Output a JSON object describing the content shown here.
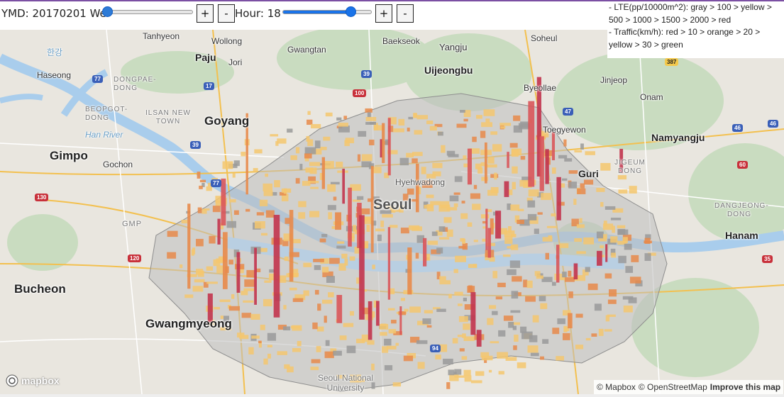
{
  "controls": {
    "ymd_label": "YMD: 20170201 We",
    "ymd_slider_level": 0.02,
    "ymd_plus": "+",
    "ymd_minus": "-",
    "hour_label": "Hour: 18",
    "hour_slider_level": 0.75,
    "hour_plus": "+",
    "hour_minus": "-"
  },
  "legend": {
    "lte": "- LTE(pp/10000m^2): gray > 100 > yellow > 500 > 1000 > 1500 > 2000 > red",
    "traffic": "- Traffic(km/h): red > 10 > orange > 20 > yellow > 30 > green"
  },
  "map": {
    "cities": [
      "Goyang",
      "Gimpo",
      "Bucheon",
      "Gwangmyeong",
      "Seoul",
      "Guri",
      "Namyangju",
      "Hanam",
      "Uijeongbu",
      "Paju"
    ],
    "towns": [
      "Tanhyeon",
      "Wollong",
      "Gwangtan",
      "Baekseok",
      "Soheul",
      "Yangju",
      "Jinjeop",
      "Haseong",
      "Jori",
      "Byeollae",
      "Onam",
      "Toegyewon",
      "Gochon",
      "Hyehwadong",
      "Seoul National University"
    ],
    "districts": [
      "DONGPAE-DONG",
      "BEOPGOT-DONG",
      "ILSAN NEW TOWN",
      "JIGEUM DONG",
      "DANGJEONG-DONG",
      "GMP"
    ],
    "water": [
      "Han River",
      "한강"
    ],
    "shields": [
      "77",
      "17",
      "100",
      "39",
      "39",
      "77",
      "47",
      "46",
      "46",
      "60",
      "130",
      "120",
      "35",
      "387",
      "94"
    ]
  },
  "footer": {
    "logo": "mapbox",
    "attrib_mapbox": "© Mapbox",
    "attrib_osm": "© OpenStreetMap",
    "improve": "Improve this map"
  },
  "colors": {
    "lte_gray": "#9a9a9a",
    "lte_yellow": "#f4c76e",
    "lte_orange": "#e8894a",
    "lte_red": "#c2344e",
    "accent": "#1a73e8"
  }
}
